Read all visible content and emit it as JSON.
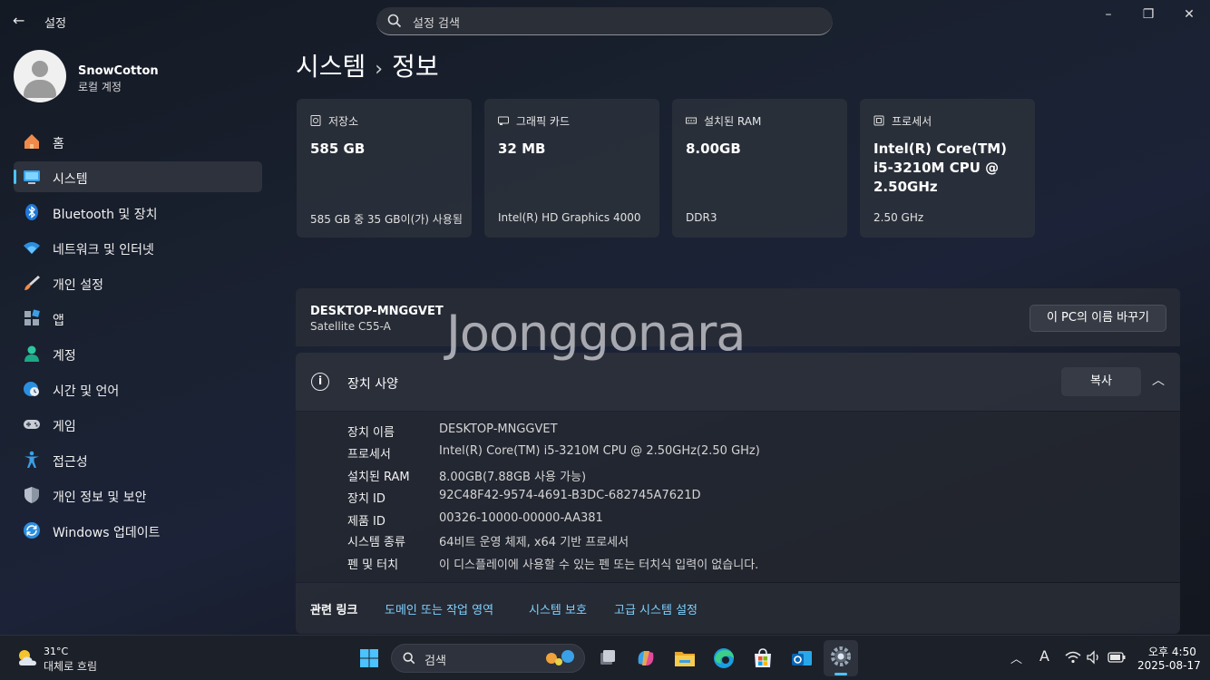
{
  "window": {
    "app_title": "설정",
    "back_icon": "arrow-left-icon",
    "controls": [
      "minimize-icon",
      "restore-icon",
      "close-icon"
    ]
  },
  "search": {
    "placeholder": "설정 검색",
    "icon": "search-icon"
  },
  "profile": {
    "name": "SnowCotton",
    "account_type": "로컬 계정"
  },
  "sidebar": {
    "items": [
      {
        "label": "홈",
        "icon": "home-icon",
        "active": false
      },
      {
        "label": "시스템",
        "icon": "monitor-icon",
        "active": true
      },
      {
        "label": "Bluetooth 및 장치",
        "icon": "bluetooth-icon",
        "active": false
      },
      {
        "label": "네트워크 및 인터넷",
        "icon": "wifi-icon",
        "active": false
      },
      {
        "label": "개인 설정",
        "icon": "brush-icon",
        "active": false
      },
      {
        "label": "앱",
        "icon": "apps-icon",
        "active": false
      },
      {
        "label": "계정",
        "icon": "person-icon",
        "active": false
      },
      {
        "label": "시간 및 언어",
        "icon": "globe-clock-icon",
        "active": false
      },
      {
        "label": "게임",
        "icon": "gamepad-icon",
        "active": false
      },
      {
        "label": "접근성",
        "icon": "accessibility-icon",
        "active": false
      },
      {
        "label": "개인 정보 및 보안",
        "icon": "shield-icon",
        "active": false
      },
      {
        "label": "Windows 업데이트",
        "icon": "update-icon",
        "active": false
      }
    ]
  },
  "page": {
    "breadcrumb_parent": "시스템",
    "breadcrumb_sep": "›",
    "breadcrumb_current": "정보"
  },
  "cards": [
    {
      "label": "저장소",
      "icon": "storage-icon",
      "value": "585 GB",
      "sub": "585 GB 중 35 GB이(가) 사용됨"
    },
    {
      "label": "그래픽 카드",
      "icon": "graphics-card-icon",
      "value": "32 MB",
      "sub": "Intel(R) HD Graphics 4000"
    },
    {
      "label": "설치된 RAM",
      "icon": "ram-icon",
      "value": "8.00GB",
      "sub": "DDR3"
    },
    {
      "label": "프로세서",
      "icon": "processor-icon",
      "value": "Intel(R) Core(TM) i5-3210M CPU @ 2.50GHz",
      "sub": "2.50 GHz"
    }
  ],
  "pc": {
    "name": "DESKTOP-MNGGVET",
    "model": "Satellite C55-A",
    "rename_label": "이 PC의 이름 바꾸기"
  },
  "watermark": "Joonggonara",
  "specs": {
    "title": "장치 사양",
    "copy_label": "복사",
    "rows": [
      {
        "key": "장치 이름",
        "value": "DESKTOP-MNGGVET"
      },
      {
        "key": "프로세서",
        "value": "Intel(R) Core(TM) i5-3210M CPU @ 2.50GHz(2.50 GHz)"
      },
      {
        "key": "설치된 RAM",
        "value": "8.00GB(7.88GB 사용 가능)"
      },
      {
        "key": "장치 ID",
        "value": "92C48F42-9574-4691-B3DC-682745A7621D"
      },
      {
        "key": "제품 ID",
        "value": "00326-10000-00000-AA381"
      },
      {
        "key": "시스템 종류",
        "value": "64비트 운영 체제, x64 기반 프로세서"
      },
      {
        "key": "펜 및 터치",
        "value": "이 디스플레이에 사용할 수 있는 펜 또는 터치식 입력이 없습니다."
      }
    ]
  },
  "related": {
    "title": "관련 링크",
    "links": [
      "도메인 또는 작업 영역",
      "시스템 보호",
      "고급 시스템 설정"
    ]
  },
  "taskbar": {
    "temperature": "31°C",
    "weather": "대체로 흐림",
    "search_placeholder": "검색",
    "apps": [
      "windows-start-icon",
      "task-view-icon",
      "copilot-icon",
      "file-explorer-icon",
      "edge-icon",
      "store-icon",
      "outlook-icon",
      "settings-icon"
    ],
    "tray_icons": [
      "chevron-up-icon",
      "ime-icon",
      "wifi-icon",
      "volume-icon",
      "battery-icon"
    ],
    "ime_label": "A",
    "time": "오후 4:50",
    "date": "2025-08-17"
  },
  "colors": {
    "accent": "#4cc2ff",
    "link": "#7fd0ff",
    "background": "#1a2130"
  }
}
